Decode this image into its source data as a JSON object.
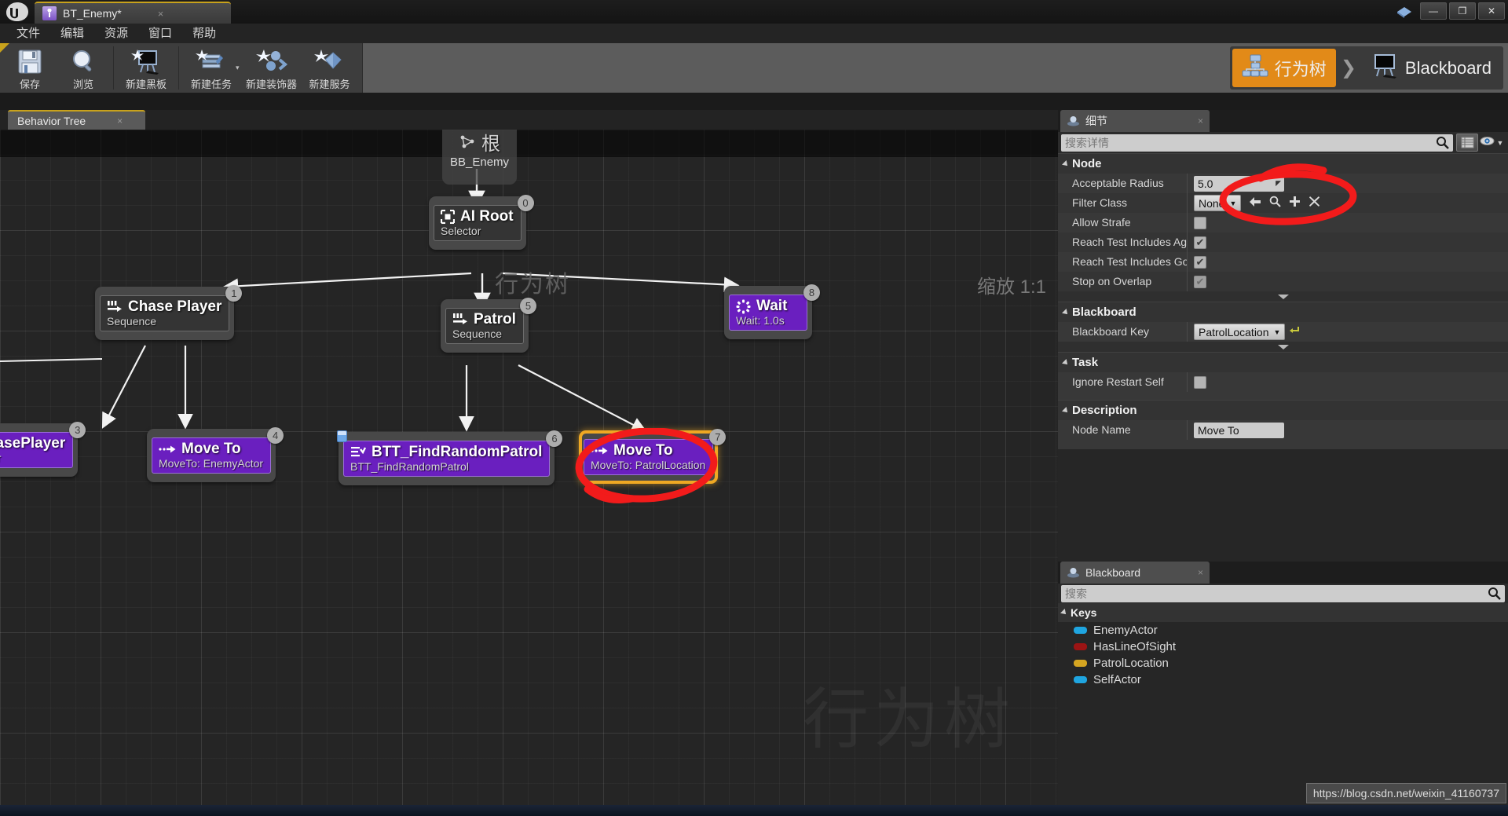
{
  "window": {
    "app_icon": "unreal-logo-icon",
    "tab_title": "BT_Enemy*",
    "tab_close": "×",
    "minimize": "—",
    "maximize": "❐",
    "close": "✕"
  },
  "menu": {
    "items": [
      {
        "label": "文件"
      },
      {
        "label": "编辑"
      },
      {
        "label": "资源"
      },
      {
        "label": "窗口"
      },
      {
        "label": "帮助"
      }
    ]
  },
  "toolbar": {
    "buttons": [
      {
        "label": "保存",
        "icon": "save-disk-icon"
      },
      {
        "label": "浏览",
        "icon": "browse-magnifier-icon"
      },
      {
        "label": "新建黑板",
        "icon": "new-blackboard-icon"
      },
      {
        "label": "新建任务",
        "icon": "new-task-icon"
      },
      {
        "label": "新建装饰器",
        "icon": "new-decorator-icon"
      },
      {
        "label": "新建服务",
        "icon": "new-service-icon"
      }
    ],
    "dropdown_caret": "▾"
  },
  "modes": {
    "behavior_tree": "行为树",
    "blackboard": "Blackboard",
    "chevron": "❯",
    "active": "行为树",
    "accent_color": "#e28a18"
  },
  "graph": {
    "tab_label": "Behavior Tree",
    "tab_close": "×",
    "header_title": "行为树",
    "zoom_label": "缩放 1:1",
    "watermark": "行为树",
    "root": {
      "title": "根",
      "subtitle": "BB_Enemy",
      "icon": "root-graph-icon"
    },
    "nodes": [
      {
        "index": "0",
        "title": "AI Root",
        "subtitle": "Selector",
        "kind": "composite",
        "icon": "selector-icon"
      },
      {
        "index": "1",
        "title": "Chase Player",
        "subtitle": "Sequence",
        "kind": "composite",
        "icon": "sequence-icon"
      },
      {
        "index": "3",
        "title": "T_ChasePlayer",
        "subtitle": "sePlayer",
        "kind": "task",
        "icon": "task-icon"
      },
      {
        "index": "4",
        "title": "Move To",
        "subtitle": "MoveTo: EnemyActor",
        "kind": "task",
        "icon": "moveto-icon"
      },
      {
        "index": "5",
        "title": "Patrol",
        "subtitle": "Sequence",
        "kind": "composite",
        "icon": "sequence-icon"
      },
      {
        "index": "6",
        "title": "BTT_FindRandomPatrol",
        "subtitle": "BTT_FindRandomPatrol",
        "kind": "task",
        "icon": "bt-task-icon"
      },
      {
        "index": "7",
        "title": "Move To",
        "subtitle": "MoveTo: PatrolLocation",
        "kind": "task",
        "icon": "moveto-icon",
        "selected": true
      },
      {
        "index": "8",
        "title": "Wait",
        "subtitle": "Wait: 1.0s",
        "kind": "task",
        "icon": "wait-icon"
      }
    ],
    "annotation_color": "#f21b1b"
  },
  "details": {
    "tab_label": "细节",
    "tab_close": "×",
    "search_placeholder": "搜索详情",
    "search_icon": "search-icon",
    "grid_icon": "grid-view-icon",
    "eye_icon": "eye-icon",
    "caret_icon": "chevron-down-icon",
    "sections": [
      {
        "title": "Node",
        "rows": [
          {
            "name": "Acceptable Radius",
            "type": "text",
            "value": "5.0"
          },
          {
            "name": "Filter Class",
            "type": "combo",
            "value": "None",
            "actions": [
              "back-arrow-icon",
              "browse-icon",
              "add-icon",
              "clear-icon"
            ]
          },
          {
            "name": "Allow Strafe",
            "type": "checkbox",
            "checked": false
          },
          {
            "name": "Reach Test Includes Agen",
            "type": "checkbox",
            "checked": true
          },
          {
            "name": "Reach Test Includes Goal",
            "type": "checkbox",
            "checked": true
          },
          {
            "name": "Stop on Overlap",
            "type": "checkbox",
            "checked": true,
            "disabled": true
          }
        ]
      },
      {
        "title": "Blackboard",
        "rows": [
          {
            "name": "Blackboard Key",
            "type": "combo",
            "value": "PatrolLocation",
            "reset_icon": "reset-arrow-icon",
            "highlighted": true
          }
        ]
      },
      {
        "title": "Task",
        "rows": [
          {
            "name": "Ignore Restart Self",
            "type": "checkbox",
            "checked": false
          }
        ]
      },
      {
        "title": "Description",
        "rows": [
          {
            "name": "Node Name",
            "type": "text",
            "value": "Move To"
          }
        ]
      }
    ]
  },
  "blackboard_panel": {
    "tab_label": "Blackboard",
    "tab_close": "×",
    "search_placeholder": "搜索",
    "search_icon": "search-icon",
    "keys_header": "Keys",
    "keys": [
      {
        "name": "EnemyActor",
        "color": "#1fa5e0"
      },
      {
        "name": "HasLineOfSight",
        "color": "#9b1414"
      },
      {
        "name": "PatrolLocation",
        "color": "#d5a521"
      },
      {
        "name": "SelfActor",
        "color": "#1fa5e0"
      }
    ]
  },
  "status": {
    "url": "https://blog.csdn.net/weixin_41160737"
  }
}
